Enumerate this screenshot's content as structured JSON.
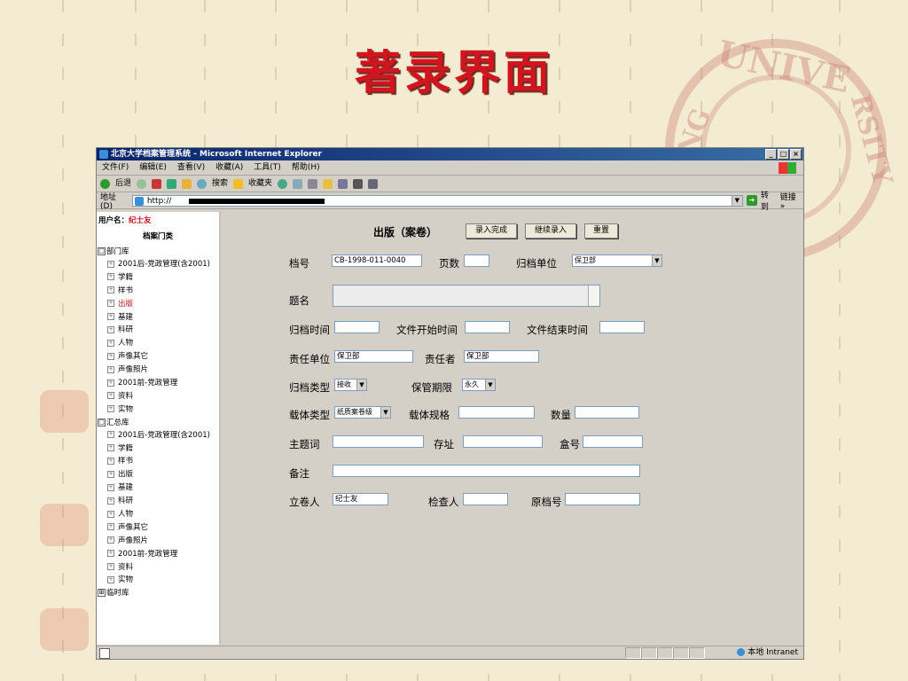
{
  "slide": {
    "title": "著录界面"
  },
  "seal": {
    "text_a": "UNIVE",
    "text_b": "KING",
    "text_c": "RSITY"
  },
  "window": {
    "title": "北京大学档案管理系统 - Microsoft Internet Explorer",
    "menu": [
      "文件(F)",
      "编辑(E)",
      "查看(V)",
      "收藏(A)",
      "工具(T)",
      "帮助(H)"
    ],
    "toolbar": [
      "后退",
      "搜索",
      "收藏夹"
    ],
    "address_label": "地址(D)",
    "address_value": "http://",
    "go_label": "转到",
    "links_label": "链接 »",
    "status_zone": "本地 Intranet"
  },
  "sidebar": {
    "user_label": "用户名：",
    "user_name": "纪士友",
    "category_heading": "档案门类",
    "groups": [
      {
        "label": "部门库",
        "toggle": "□",
        "items": [
          "2001后-党政管理(含2001)",
          "学籍",
          "样书",
          "出版",
          "基建",
          "科研",
          "人物",
          "声像其它",
          "声像照片",
          "2001前-党政管理",
          "资料",
          "实物"
        ],
        "active": "出版"
      },
      {
        "label": "汇总库",
        "toggle": "□",
        "items": [
          "2001后-党政管理(含2001)",
          "学籍",
          "样书",
          "出版",
          "基建",
          "科研",
          "人物",
          "声像其它",
          "声像照片",
          "2001前-党政管理",
          "资料",
          "实物"
        ]
      },
      {
        "label": "临时库",
        "toggle": "⊞",
        "items": []
      }
    ]
  },
  "form": {
    "title": "出版（案卷）",
    "buttons": {
      "complete": "录入完成",
      "continue": "继续录入",
      "reset": "重置"
    },
    "fields": {
      "dang_hao": {
        "label": "档号",
        "value": "CB-1998-011-0040"
      },
      "ye_shu": {
        "label": "页数",
        "value": ""
      },
      "gui_dang_dan_wei": {
        "label": "归档单位",
        "value": "保卫部"
      },
      "ti_ming": {
        "label": "题名",
        "value": ""
      },
      "gui_dang_shi_jian": {
        "label": "归档时间",
        "value": ""
      },
      "kai_shi_shi_jian": {
        "label": "文件开始时间",
        "value": ""
      },
      "jie_shu_shi_jian": {
        "label": "文件结束时间",
        "value": ""
      },
      "ze_ren_dan_wei": {
        "label": "责任单位",
        "value": "保卫部"
      },
      "ze_ren_zhe": {
        "label": "责任者",
        "value": "保卫部"
      },
      "gui_dang_lei_xing": {
        "label": "归档类型",
        "value": "接收"
      },
      "bao_guan_qi_xian": {
        "label": "保管期限",
        "value": "永久"
      },
      "zai_ti_lei_xing": {
        "label": "载体类型",
        "value": "纸质案卷级"
      },
      "zai_ti_gui_ge": {
        "label": "载体规格",
        "value": ""
      },
      "shu_liang": {
        "label": "数量",
        "value": ""
      },
      "zhu_ti_ci": {
        "label": "主题词",
        "value": ""
      },
      "cun_zhi": {
        "label": "存址",
        "value": ""
      },
      "he_hao": {
        "label": "盒号",
        "value": ""
      },
      "bei_zhu": {
        "label": "备注",
        "value": ""
      },
      "li_juan_ren": {
        "label": "立卷人",
        "value": "纪士友"
      },
      "jian_cha_ren": {
        "label": "检查人",
        "value": ""
      },
      "yuan_dang_hao": {
        "label": "原档号",
        "value": ""
      }
    }
  }
}
